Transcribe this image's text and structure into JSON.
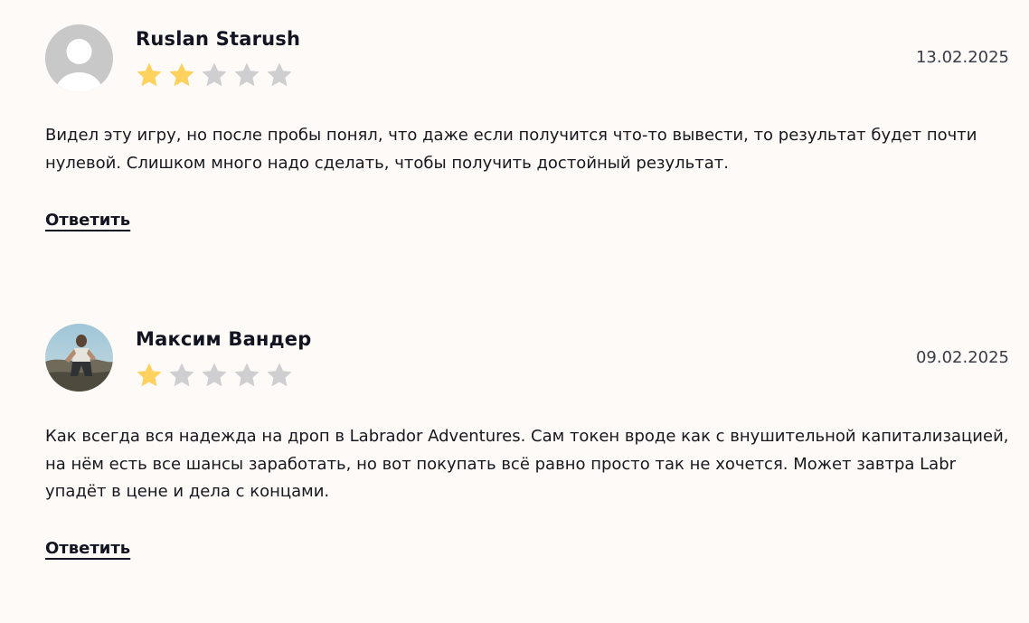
{
  "reviews": [
    {
      "author": "Ruslan Starush",
      "rating": 2,
      "max_rating": 5,
      "date": "13.02.2025",
      "text": "Видел эту игру, но после пробы понял, что даже если получится что-то вывести, то результат будет почти нулевой. Слишком много надо сделать, чтобы получить достойный результат.",
      "reply_label": "Ответить",
      "avatar": "default-user-avatar"
    },
    {
      "author": "Максим Вандер",
      "rating": 1,
      "max_rating": 5,
      "date": "09.02.2025",
      "text": "Как всегда вся надежда на дроп в Labrador Adventures. Сам токен вроде как с внушительной капитализацией, на нём есть все шансы заработать, но вот покупать всё равно просто так не хочется. Может завтра Labr упадёт в цене и дела с концами.",
      "reply_label": "Ответить",
      "avatar": "user-photo-avatar"
    }
  ],
  "colors": {
    "background": "#fdfaf7",
    "star_filled": "#ffd25f",
    "star_empty": "#cfcfd1",
    "text": "#14161f"
  }
}
